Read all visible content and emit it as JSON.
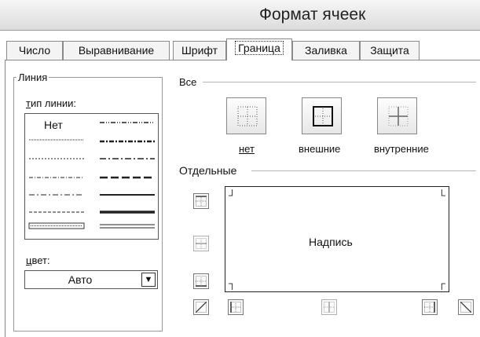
{
  "window": {
    "title": "Формат ячеек"
  },
  "tabs": [
    {
      "label": "Число"
    },
    {
      "label": "Выравнивание"
    },
    {
      "label": "Шрифт"
    },
    {
      "label": "Граница"
    },
    {
      "label": "Заливка"
    },
    {
      "label": "Защита"
    }
  ],
  "active_tab": "Граница",
  "line_group": {
    "title": "Линия",
    "style_label": "тип линии:",
    "none_label": "Нет",
    "styles_left": [
      "hair",
      "dotted",
      "dashdot-thin",
      "dashed-thin",
      "dashed-medium",
      "double"
    ],
    "styles_right": [
      "dashdotdot",
      "dashdotdot-medium",
      "dashdot",
      "dashdot-medium",
      "thin",
      "medium",
      "thick",
      "double-thin"
    ],
    "color_label": "цвет:",
    "color_value": "Авто"
  },
  "presets": {
    "title": "Все",
    "buttons": [
      {
        "label": "нет",
        "icon": "border-none-icon"
      },
      {
        "label": "внешние",
        "icon": "border-outline-icon"
      },
      {
        "label": "внутренние",
        "icon": "border-inside-icon"
      }
    ]
  },
  "individual": {
    "title": "Отдельные",
    "preview_text": "Надпись"
  }
}
